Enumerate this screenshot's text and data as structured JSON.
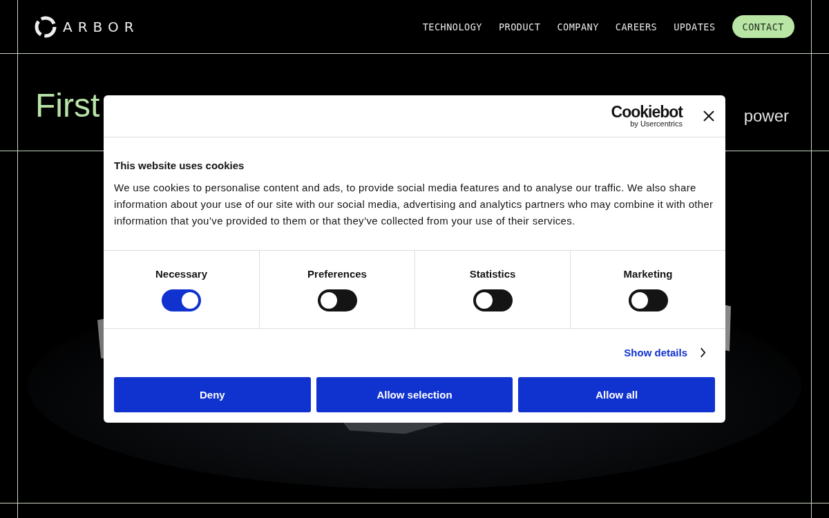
{
  "header": {
    "logo": "ARBOR",
    "nav": [
      {
        "label": "TECHNOLOGY"
      },
      {
        "label": "PRODUCT"
      },
      {
        "label": "COMPANY"
      },
      {
        "label": "CAREERS"
      },
      {
        "label": "UPDATES"
      }
    ],
    "contact": "CONTACT"
  },
  "hero": {
    "title": "First",
    "subtitle": [
      "power"
    ]
  },
  "cookie_dialog": {
    "brand": "Cookiebot",
    "brand_sub": "by Usercentrics",
    "heading": "This website uses cookies",
    "body": "We use cookies to personalise content and ads, to provide social media features and to analyse our traffic. We also share information about your use of our site with our social media, advertising and analytics partners who may combine it with other information that you’ve provided to them or that they’ve collected from your use of their services.",
    "categories": [
      {
        "label": "Necessary",
        "on": true
      },
      {
        "label": "Preferences",
        "on": false
      },
      {
        "label": "Statistics",
        "on": false
      },
      {
        "label": "Marketing",
        "on": false
      }
    ],
    "details_link": "Show details",
    "buttons": [
      "Deny",
      "Allow selection",
      "Allow all"
    ]
  }
}
